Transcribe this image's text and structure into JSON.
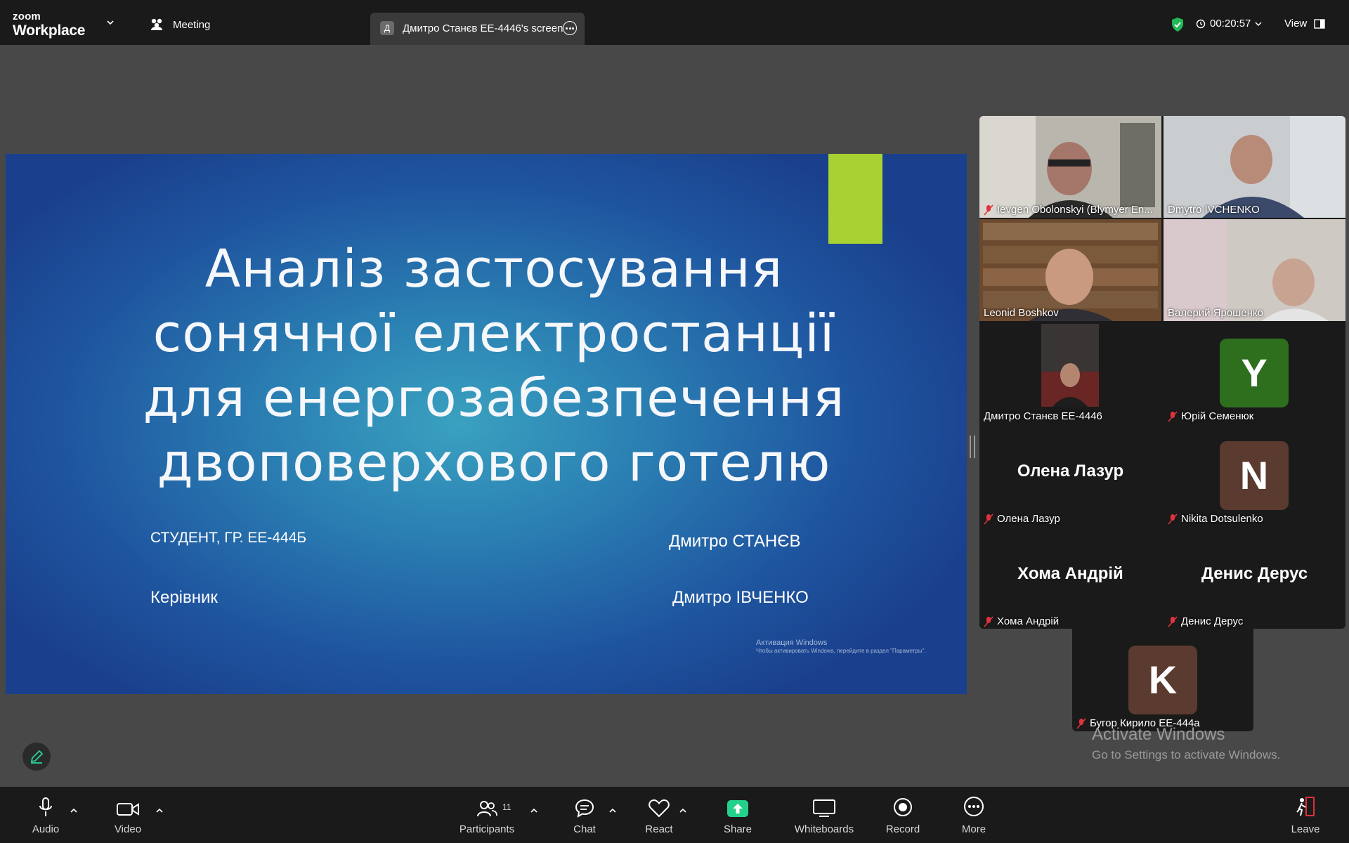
{
  "app": {
    "logo_line1": "zoom",
    "logo_line2": "Workplace",
    "meeting_label": "Meeting",
    "share_tab_avatar": "Д",
    "share_tab_title": "Дмитро Станєв EE-4446's screen",
    "timer": "00:20:57",
    "view_label": "View"
  },
  "slide": {
    "title_lines": [
      "Аналіз застосування",
      "сонячної електростанції",
      "для енергозабезпечення",
      "двоповерхового готелю"
    ],
    "student_label": "СТУДЕНТ, ГР. ЕЕ-444Б",
    "student_name": "Дмитро СТАНЄВ",
    "supervisor_label": "Керівник",
    "supervisor_name": "Дмитро ІВЧЕНКО",
    "watermark_line1": "Активация Windows",
    "watermark_line2": "Чтобы активировать Windows, перейдите в раздел \"Параметры\".",
    "accent_color": "#a8d232"
  },
  "participants": [
    {
      "name": "Ievgen Obolonskyi (Blymyer En...",
      "muted": true
    },
    {
      "name": "Dmytro IVCHENKO",
      "muted": false
    },
    {
      "name": "Leonid Boshkov",
      "muted": false
    },
    {
      "name": "Валерий Ярошенко",
      "muted": false
    },
    {
      "name": "Дмитро Станєв EE-4446",
      "muted": false
    },
    {
      "name": "Юрій Семенюк",
      "muted": true,
      "initial": "Y",
      "color": "#2e6f1e"
    },
    {
      "name": "Олена Лазур",
      "muted": true,
      "center": "Олена Лазур"
    },
    {
      "name": "Nikita Dotsulenko",
      "muted": true,
      "initial": "N",
      "color": "#5b3a30"
    },
    {
      "name": "Хома Андрій",
      "muted": true,
      "center": "Хома Андрій"
    },
    {
      "name": "Денис Дерус",
      "muted": true,
      "center": "Денис Дерус"
    },
    {
      "name": "Бугор Кирило EE-444a",
      "muted": true,
      "initial": "K",
      "color": "#5b3a30"
    }
  ],
  "windows_watermark": {
    "line1": "Activate Windows",
    "line2": "Go to Settings to activate Windows."
  },
  "toolbar": {
    "audio": "Audio",
    "video": "Video",
    "participants": "Participants",
    "participants_count": "11",
    "chat": "Chat",
    "react": "React",
    "share": "Share",
    "whiteboards": "Whiteboards",
    "record": "Record",
    "more": "More",
    "leave": "Leave"
  },
  "colors": {
    "active_speaker_border": "#2ad195",
    "share_green": "#23d18b",
    "muted_red": "#e0323c",
    "shield_green": "#23b856"
  },
  "icons": [
    "chevron-down-icon",
    "meeting-icon",
    "more-icon",
    "shield-icon",
    "clock-icon",
    "view-icon",
    "mic-off-icon",
    "pen-icon",
    "mic-icon",
    "video-icon",
    "participants-icon",
    "chat-icon",
    "react-icon",
    "share-icon",
    "whiteboard-icon",
    "record-icon",
    "more-icon",
    "leave-icon"
  ]
}
